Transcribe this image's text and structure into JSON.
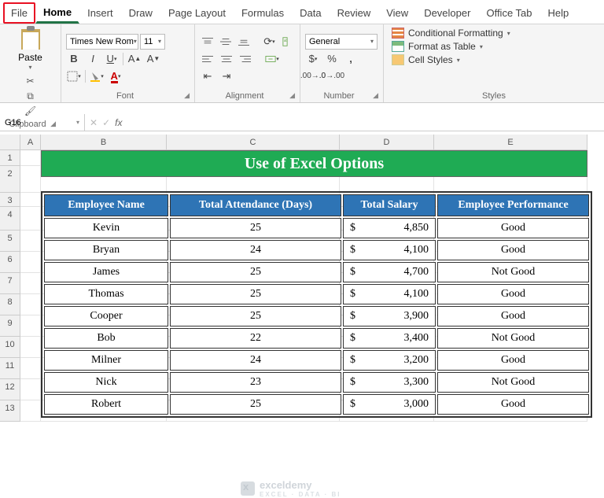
{
  "tabs": {
    "file": "File",
    "home": "Home",
    "insert": "Insert",
    "draw": "Draw",
    "pagelayout": "Page Layout",
    "formulas": "Formulas",
    "data": "Data",
    "review": "Review",
    "view": "View",
    "developer": "Developer",
    "officetab": "Office Tab",
    "help": "Help"
  },
  "ribbon": {
    "clipboard": {
      "paste": "Paste",
      "label": "Clipboard"
    },
    "font": {
      "name": "Times New Rom",
      "size": "11",
      "label": "Font"
    },
    "alignment": {
      "label": "Alignment"
    },
    "number": {
      "format": "General",
      "label": "Number"
    },
    "styles": {
      "cond": "Conditional Formatting",
      "table": "Format as Table",
      "cell": "Cell Styles",
      "label": "Styles"
    }
  },
  "namebox": "G16",
  "sheet": {
    "cols": {
      "A": "A",
      "B": "B",
      "C": "C",
      "D": "D",
      "E": "E"
    },
    "rows": [
      "1",
      "2",
      "3",
      "4",
      "5",
      "6",
      "7",
      "8",
      "9",
      "10",
      "11",
      "12",
      "13"
    ],
    "title": "Use of Excel Options",
    "headers": {
      "name": "Employee Name",
      "att": "Total Attendance (Days)",
      "sal": "Total Salary",
      "perf": "Employee Performance"
    },
    "data": [
      {
        "name": "Kevin",
        "att": "25",
        "sal": "4,850",
        "perf": "Good"
      },
      {
        "name": "Bryan",
        "att": "24",
        "sal": "4,100",
        "perf": "Good"
      },
      {
        "name": "James",
        "att": "25",
        "sal": "4,700",
        "perf": "Not Good"
      },
      {
        "name": "Thomas",
        "att": "25",
        "sal": "4,100",
        "perf": "Good"
      },
      {
        "name": "Cooper",
        "att": "25",
        "sal": "3,900",
        "perf": "Good"
      },
      {
        "name": "Bob",
        "att": "22",
        "sal": "3,400",
        "perf": "Not Good"
      },
      {
        "name": "Milner",
        "att": "24",
        "sal": "3,200",
        "perf": "Good"
      },
      {
        "name": "Nick",
        "att": "23",
        "sal": "3,300",
        "perf": "Not Good"
      },
      {
        "name": "Robert",
        "att": "25",
        "sal": "3,000",
        "perf": "Good"
      }
    ],
    "currency": "$"
  },
  "watermark": {
    "brand": "exceldemy",
    "sub": "EXCEL · DATA · BI"
  },
  "fx_label": "fx"
}
